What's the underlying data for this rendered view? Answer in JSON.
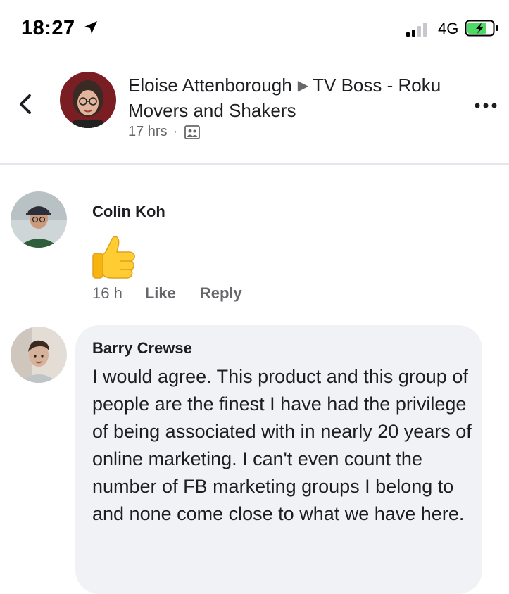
{
  "status_bar": {
    "time": "18:27",
    "network": "4G",
    "icons": [
      "location-arrow-icon",
      "cellular-signal-icon",
      "battery-charging-icon"
    ]
  },
  "header": {
    "author": "Eloise Attenborough",
    "group": "TV Boss - Roku Movers and Shakers",
    "time_ago": "17 hrs",
    "separator": "·",
    "icons": [
      "back-chevron-icon",
      "triangle-right-icon",
      "group-privacy-icon",
      "more-options-icon"
    ]
  },
  "comments": [
    {
      "author": "Colin Koh",
      "reaction_emoji": "thumbs-up-emoji",
      "time_ago": "16 h",
      "like_label": "Like",
      "reply_label": "Reply"
    },
    {
      "author": "Barry Crewse",
      "text": "I would agree. This product and this group of people are the finest I have had the privilege of being associated with in nearly 20 years of online marketing. I can't even count the number of FB marketing groups I belong to and none come close to what we have here."
    }
  ],
  "colors": {
    "text_primary": "#1c1e21",
    "text_secondary": "#65676b",
    "bubble_bg": "#f0f2f5",
    "battery_charge": "#4cd964"
  }
}
